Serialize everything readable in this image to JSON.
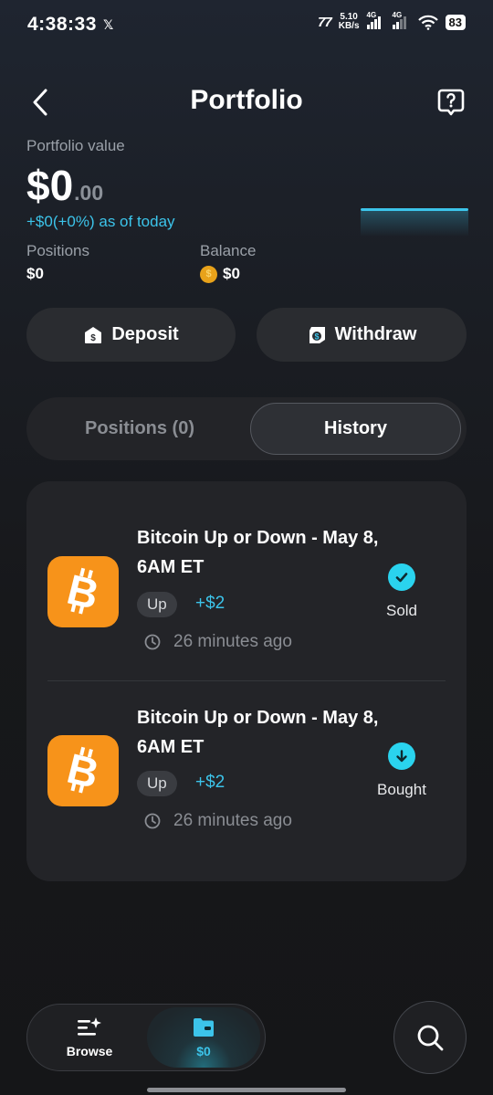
{
  "status_bar": {
    "time": "4:38:33",
    "x_icon": "x-logo-icon",
    "carrier_icon": "77",
    "net_speed_value": "5.10",
    "net_speed_unit": "KB/s",
    "sim1_label": "4G",
    "sim2_label": "4G",
    "battery": "83"
  },
  "header": {
    "title": "Portfolio",
    "back_icon": "chevron-left-icon",
    "help_icon": "help-question-icon"
  },
  "portfolio": {
    "label": "Portfolio value",
    "amount_main": "$0",
    "amount_cents": ".00",
    "change_text": "+$0(+0%) as of today",
    "positions_label": "Positions",
    "positions_value": "$0",
    "balance_label": "Balance",
    "balance_value": "$0"
  },
  "actions": {
    "deposit_label": "Deposit",
    "withdraw_label": "Withdraw"
  },
  "tabs": [
    {
      "label": "Positions (0)",
      "active": false
    },
    {
      "label": "History",
      "active": true
    }
  ],
  "history": [
    {
      "title": "Bitcoin Up or Down - May 8, 6AM ET",
      "outcome": "Up",
      "amount": "+$2",
      "time": "26 minutes ago",
      "status": "Sold",
      "status_icon": "check-icon"
    },
    {
      "title": "Bitcoin Up or Down - May 8, 6AM ET",
      "outcome": "Up",
      "amount": "+$2",
      "time": "26 minutes ago",
      "status": "Bought",
      "status_icon": "arrow-down-icon"
    }
  ],
  "bottom_nav": {
    "browse_label": "Browse",
    "portfolio_label": "$0",
    "search_icon": "search-icon"
  },
  "colors": {
    "accent": "#3cc4ea",
    "bitcoin": "#f7931a",
    "status_dot": "#2ad3ee",
    "background": "#161719"
  }
}
